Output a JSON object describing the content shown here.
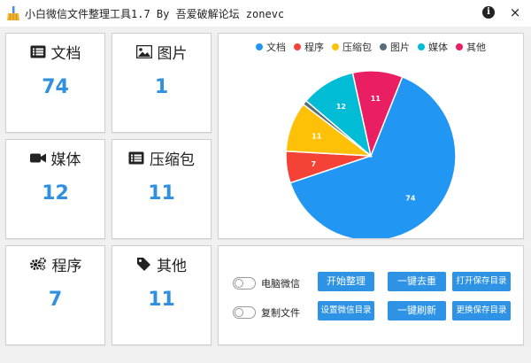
{
  "window": {
    "title": "小白微信文件整理工具1.7 By 吾爱破解论坛 zonevc"
  },
  "stats": [
    {
      "label": "文档",
      "value": "74",
      "icon": "document-list-icon"
    },
    {
      "label": "图片",
      "value": "1",
      "icon": "image-icon"
    },
    {
      "label": "媒体",
      "value": "12",
      "icon": "video-camera-icon"
    },
    {
      "label": "压缩包",
      "value": "11",
      "icon": "archive-icon"
    },
    {
      "label": "程序",
      "value": "7",
      "icon": "gears-icon"
    },
    {
      "label": "其他",
      "value": "11",
      "icon": "tag-icon"
    }
  ],
  "chart_data": {
    "type": "pie",
    "legend_position": "top",
    "series": [
      {
        "name": "文档",
        "value": 74,
        "color": "#2196f3"
      },
      {
        "name": "程序",
        "value": 7,
        "color": "#f44336"
      },
      {
        "name": "压缩包",
        "value": 11,
        "color": "#ffc107"
      },
      {
        "name": "图片",
        "value": 1,
        "color": "#546e7a"
      },
      {
        "name": "媒体",
        "value": 12,
        "color": "#00bcd4"
      },
      {
        "name": "其他",
        "value": 11,
        "color": "#e91e63"
      }
    ]
  },
  "controls": {
    "toggles": [
      {
        "label": "电脑微信",
        "checked": false
      },
      {
        "label": "复制文件",
        "checked": false
      }
    ],
    "buttons": {
      "start": "开始整理",
      "dedupe": "一键去重",
      "open_save_dir": "打开保存目录",
      "set_wechat_dir": "设置微信目录",
      "refresh": "一键刷新",
      "change_save_dir": "更换保存目录"
    }
  }
}
